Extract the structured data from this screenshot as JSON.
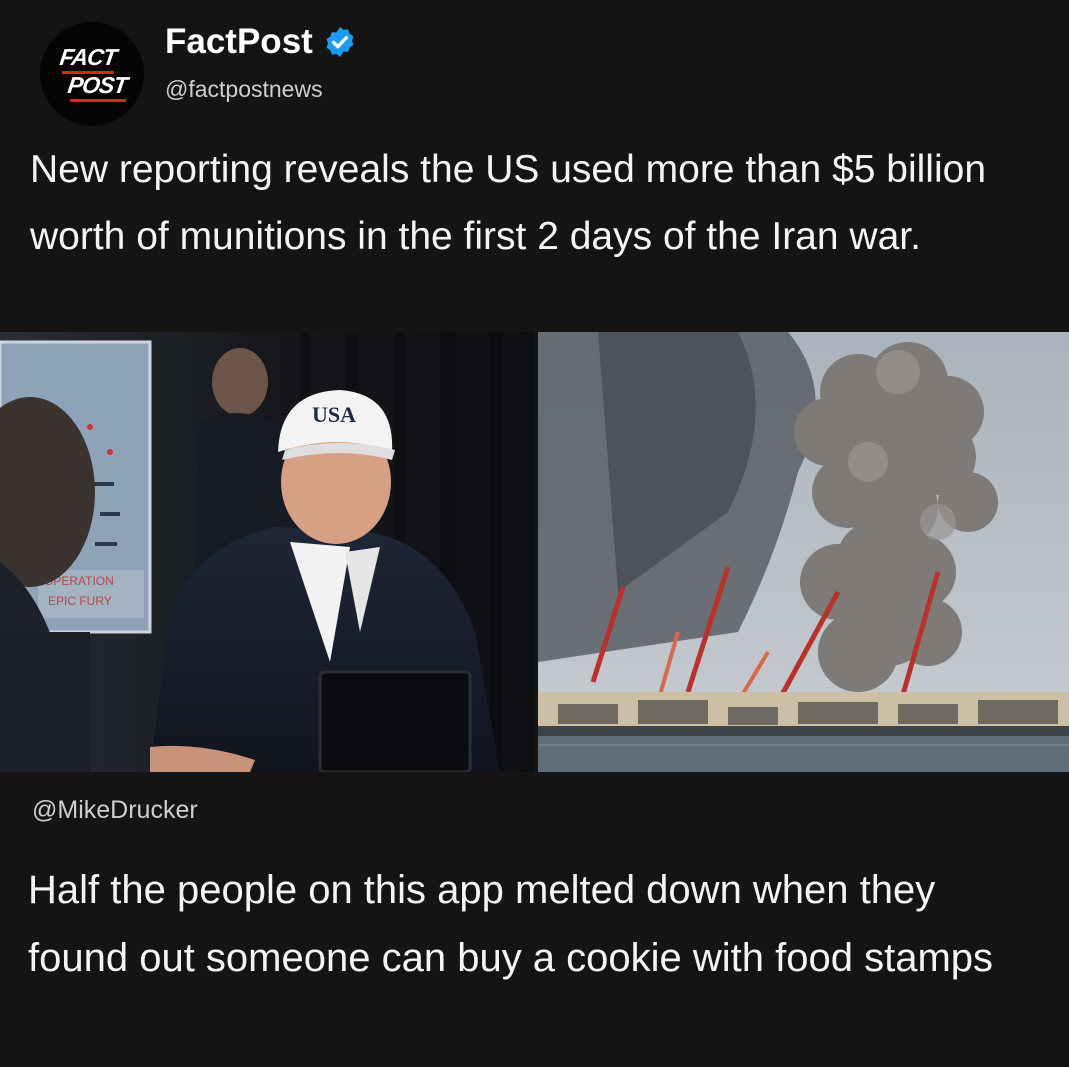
{
  "post": {
    "display_name": "FactPost",
    "handle": "@factpostnews",
    "verified": true,
    "avatar": {
      "logo_top": "FACT",
      "logo_bottom": "POST"
    },
    "text": "New reporting reveals the US used more than $5 billion worth of munitions in the first 2 days of the Iran war."
  },
  "media": {
    "left_image": {
      "icon": "photo-situation-room",
      "sign_line1": "OPERATION",
      "sign_line2": "EPIC FURY",
      "cap_text": "USA"
    },
    "right_image": {
      "icon": "photo-explosion-harbor"
    }
  },
  "quote": {
    "credit": "@MikeDrucker",
    "text": "Half the people on this app melted down when they found out someone can buy a cookie with food stamps"
  },
  "colors": {
    "background": "#141414",
    "text": "#f4f4f4",
    "secondary_text": "#cfcfcf",
    "verified": "#1d9bf0"
  }
}
